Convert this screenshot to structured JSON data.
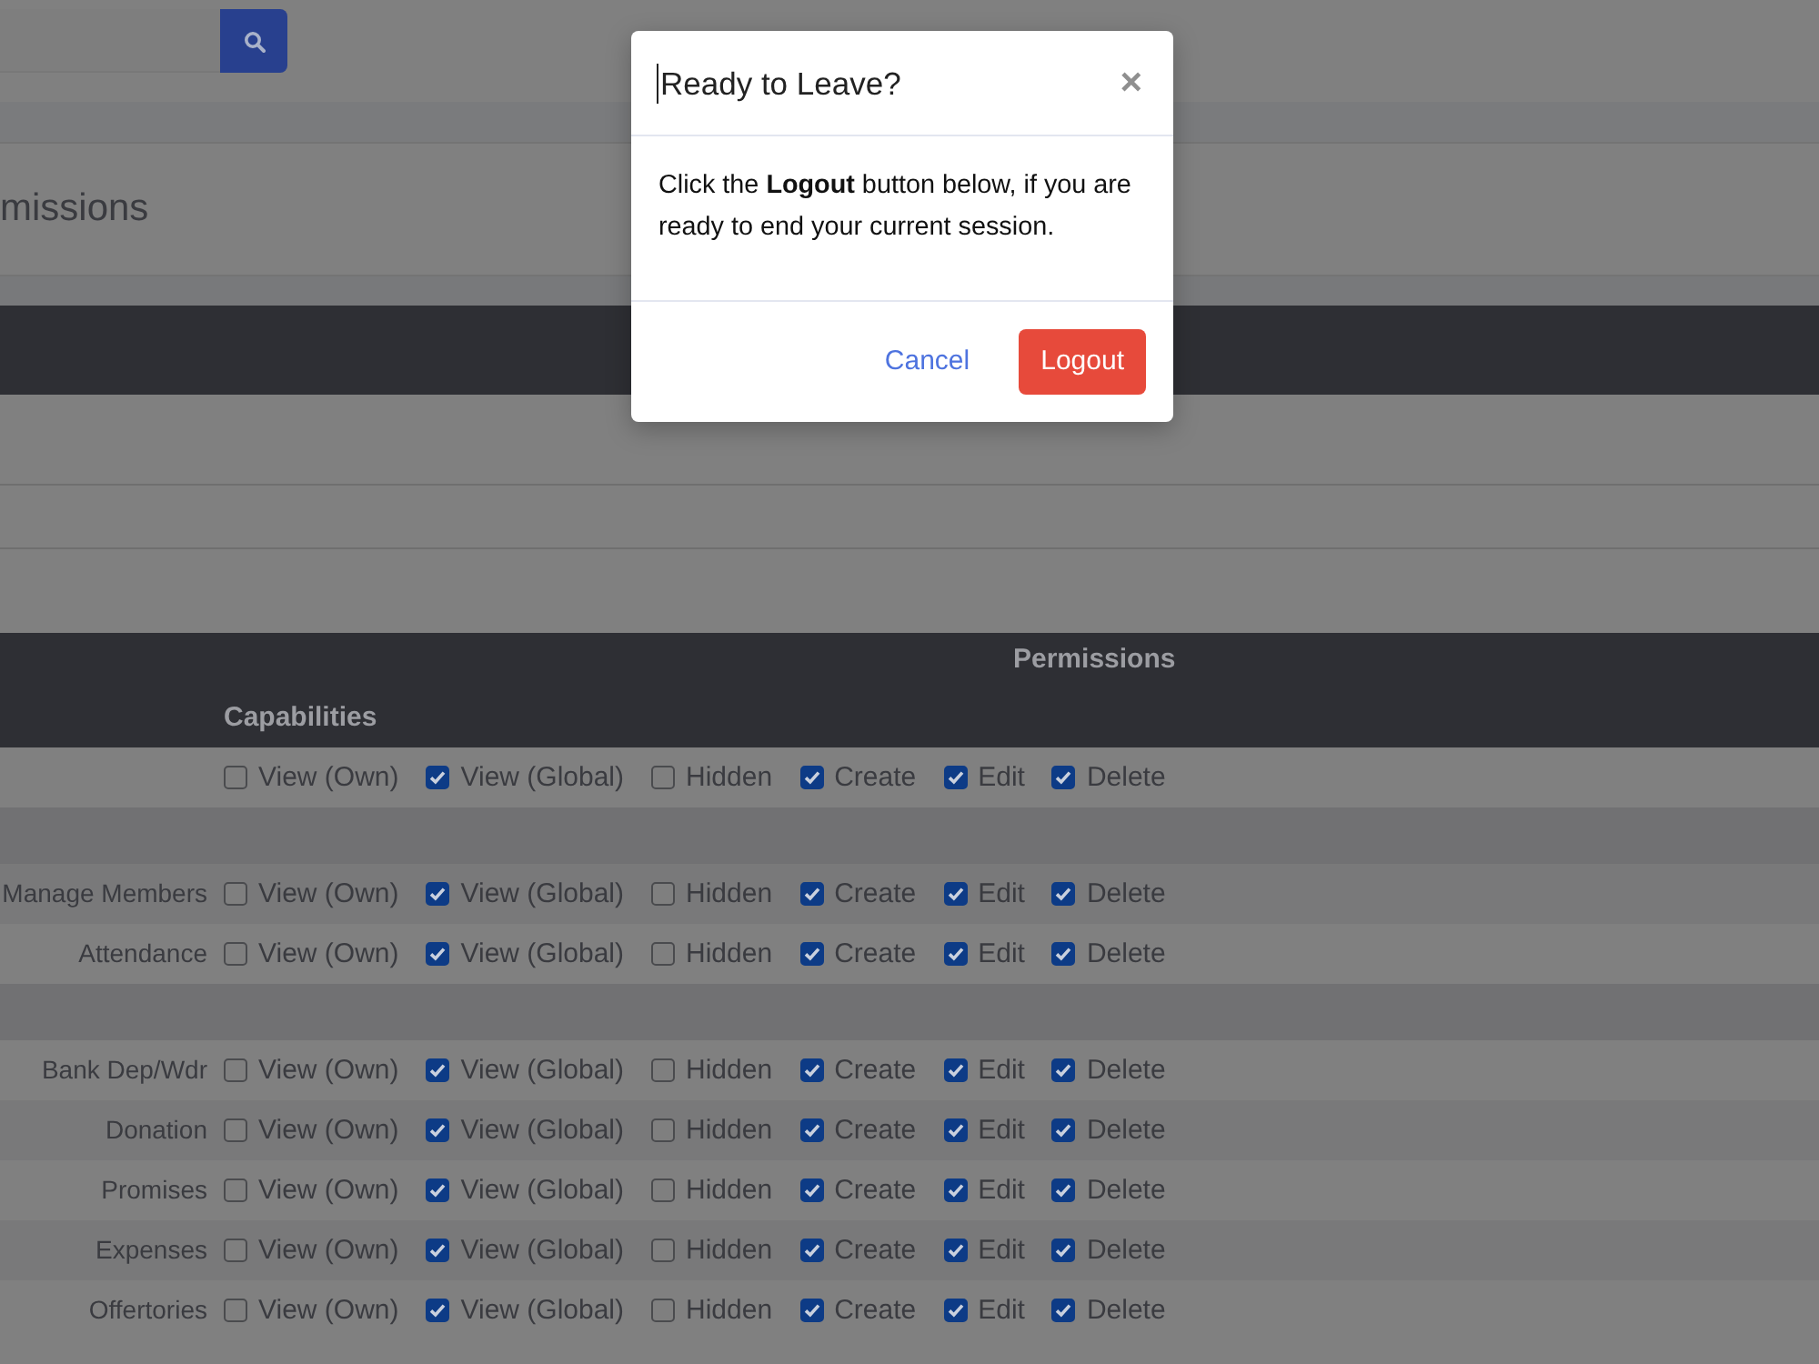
{
  "page": {
    "title": "missions"
  },
  "permissions_table": {
    "header": "Permissions",
    "subheader": "Capabilities",
    "rows": [
      {
        "kind": "permission",
        "options": [
          {
            "label": "View (Own)",
            "checked": false
          },
          {
            "label": "View (Global)",
            "checked": true
          },
          {
            "label": "Hidden",
            "checked": false
          },
          {
            "label": "Create",
            "checked": true
          },
          {
            "label": "Edit",
            "checked": true
          },
          {
            "label": "Delete",
            "checked": true
          }
        ]
      },
      {
        "kind": "spacer"
      },
      {
        "kind": "permission",
        "label": "Manage Members",
        "options": [
          {
            "label": "View (Own)",
            "checked": false
          },
          {
            "label": "View (Global)",
            "checked": true
          },
          {
            "label": "Hidden",
            "checked": false
          },
          {
            "label": "Create",
            "checked": true
          },
          {
            "label": "Edit",
            "checked": true
          },
          {
            "label": "Delete",
            "checked": true
          }
        ]
      },
      {
        "kind": "permission",
        "label": "Attendance",
        "options": [
          {
            "label": "View (Own)",
            "checked": false
          },
          {
            "label": "View (Global)",
            "checked": true
          },
          {
            "label": "Hidden",
            "checked": false
          },
          {
            "label": "Create",
            "checked": true
          },
          {
            "label": "Edit",
            "checked": true
          },
          {
            "label": "Delete",
            "checked": true
          }
        ]
      },
      {
        "kind": "spacer"
      },
      {
        "kind": "permission",
        "label": "Bank Dep/Wdr",
        "options": [
          {
            "label": "View (Own)",
            "checked": false
          },
          {
            "label": "View (Global)",
            "checked": true
          },
          {
            "label": "Hidden",
            "checked": false
          },
          {
            "label": "Create",
            "checked": true
          },
          {
            "label": "Edit",
            "checked": true
          },
          {
            "label": "Delete",
            "checked": true
          }
        ]
      },
      {
        "kind": "permission",
        "label": "Donation",
        "options": [
          {
            "label": "View (Own)",
            "checked": false
          },
          {
            "label": "View (Global)",
            "checked": true
          },
          {
            "label": "Hidden",
            "checked": false
          },
          {
            "label": "Create",
            "checked": true
          },
          {
            "label": "Edit",
            "checked": true
          },
          {
            "label": "Delete",
            "checked": true
          }
        ]
      },
      {
        "kind": "permission",
        "label": "Promises",
        "options": [
          {
            "label": "View (Own)",
            "checked": false
          },
          {
            "label": "View (Global)",
            "checked": true
          },
          {
            "label": "Hidden",
            "checked": false
          },
          {
            "label": "Create",
            "checked": true
          },
          {
            "label": "Edit",
            "checked": true
          },
          {
            "label": "Delete",
            "checked": true
          }
        ]
      },
      {
        "kind": "permission",
        "label": "Expenses",
        "options": [
          {
            "label": "View (Own)",
            "checked": false
          },
          {
            "label": "View (Global)",
            "checked": true
          },
          {
            "label": "Hidden",
            "checked": false
          },
          {
            "label": "Create",
            "checked": true
          },
          {
            "label": "Edit",
            "checked": true
          },
          {
            "label": "Delete",
            "checked": true
          }
        ]
      },
      {
        "kind": "permission",
        "label": "Offertories",
        "options": [
          {
            "label": "View (Own)",
            "checked": false
          },
          {
            "label": "View (Global)",
            "checked": true
          },
          {
            "label": "Hidden",
            "checked": false
          },
          {
            "label": "Create",
            "checked": true
          },
          {
            "label": "Edit",
            "checked": true
          },
          {
            "label": "Delete",
            "checked": true
          }
        ]
      }
    ]
  },
  "modal": {
    "title": "Ready to Leave?",
    "close": "×",
    "message": "Click the **Logout** button below, if you are ready to end your current session.",
    "buttons": [
      {
        "label": "Cancel",
        "kind": "link"
      },
      {
        "label": "Logout",
        "kind": "danger"
      }
    ]
  }
}
